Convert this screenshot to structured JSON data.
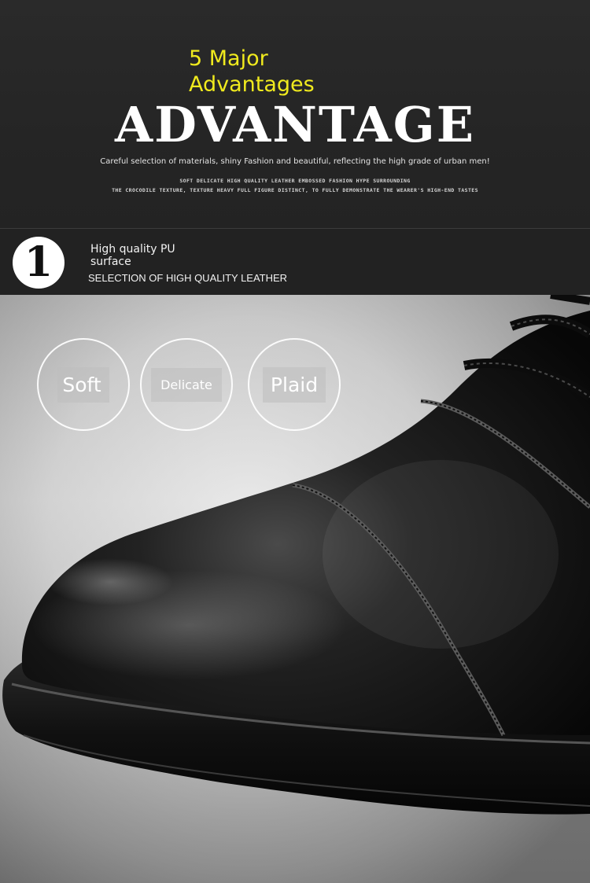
{
  "header": {
    "major_line1": "5 Major",
    "major_line2": "Advantages",
    "headline": "ADVANTAGE",
    "tagline": "Careful selection of materials, shiny Fashion and beautiful, reflecting the high grade of urban men!",
    "small_line1": "SOFT DELICATE HIGH QUALITY LEATHER  EMBOSSED FASHION HYPE SURROUNDING",
    "small_line2": "THE CROCODILE TEXTURE, TEXTURE HEAVY FULL FIGURE  DISTINCT, TO FULLY DEMONSTRATE   THE WEARER'S HIGH-END TASTES"
  },
  "feature": {
    "number": "1",
    "title_line1": "High quality PU",
    "title_line2": "surface",
    "subtitle": "SELECTION OF HIGH QUALITY LEATHER"
  },
  "badges": [
    "Soft",
    "Delicate",
    "Plaid"
  ],
  "colors": {
    "accent_yellow": "#f0ea1e",
    "background_dark": "#252525",
    "badge_white": "#ffffff"
  }
}
